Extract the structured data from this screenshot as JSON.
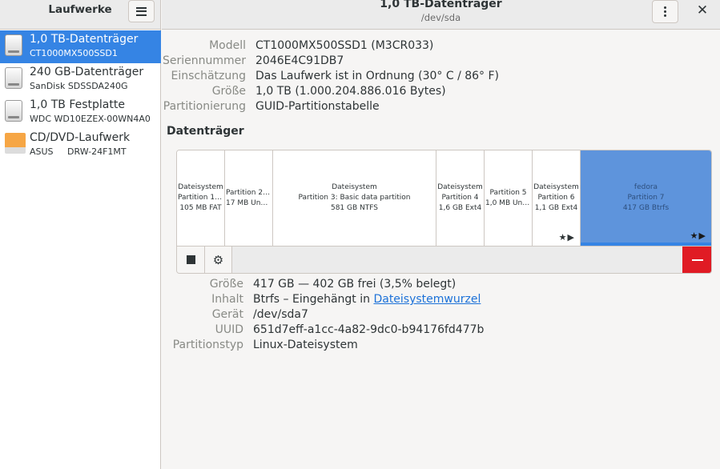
{
  "sidebar": {
    "title": "Laufwerke",
    "drives": [
      {
        "name": "1,0 TB-Datenträger",
        "model": "CT1000MX500SSD1",
        "icon": "hard-disk-icon"
      },
      {
        "name": "240 GB-Datenträger",
        "model": "SanDisk SDSSDA240G",
        "icon": "hard-disk-icon"
      },
      {
        "name": "1,0 TB Festplatte",
        "model": "WDC WD10EZEX-00WN4A0",
        "icon": "hard-disk-icon"
      },
      {
        "name": "CD/DVD-Laufwerk",
        "model": "ASUS     DRW-24F1MT",
        "icon": "optical-drive-icon"
      }
    ]
  },
  "header": {
    "title": "1,0 TB-Datenträger",
    "subtitle": "/dev/sda"
  },
  "drive_info": {
    "model_label": "Modell",
    "model": "CT1000MX500SSD1 (M3CR033)",
    "serial_label": "Seriennummer",
    "serial": "2046E4C91DB7",
    "assessment_label": "Einschätzung",
    "assessment": "Das Laufwerk ist in Ordnung (30° C / 86° F)",
    "size_label": "Größe",
    "size": "1,0 TB (1.000.204.886.016 Bytes)",
    "partitioning_label": "Partitionierung",
    "partitioning": "GUID-Partitionstabelle"
  },
  "section_title": "Datenträger",
  "partitions": [
    {
      "l1": "Dateisystem",
      "l2": "Partition 1: E...",
      "l3": "105 MB FAT",
      "marks": ""
    },
    {
      "l1": "",
      "l2": "Partition 2: ...",
      "l3": "17 MB Unbe...",
      "marks": ""
    },
    {
      "l1": "Dateisystem",
      "l2": "Partition 3: Basic data partition",
      "l3": "581 GB NTFS",
      "marks": ""
    },
    {
      "l1": "Dateisystem",
      "l2": "Partition 4",
      "l3": "1,6 GB Ext4",
      "marks": ""
    },
    {
      "l1": "",
      "l2": "Partition 5",
      "l3": "1,0 MB Unb...",
      "marks": ""
    },
    {
      "l1": "Dateisystem",
      "l2": "Partition 6",
      "l3": "1,1 GB Ext4",
      "marks": "★▶"
    },
    {
      "l1": "fedora",
      "l2": "Partition 7",
      "l3": "417 GB Btrfs",
      "marks": "★▶"
    }
  ],
  "partition_info": {
    "size_label": "Größe",
    "size": "417 GB — 402 GB frei (3,5% belegt)",
    "content_label": "Inhalt",
    "content_prefix": "Btrfs – Eingehängt in ",
    "content_link": "Dateisystemwurzel",
    "device_label": "Gerät",
    "device": "/dev/sda7",
    "uuid_label": "UUID",
    "uuid": "651d7eff-a1cc-4a82-9dc0-b94176fd477b",
    "type_label": "Partitionstyp",
    "type": "Linux-Dateisystem"
  },
  "colors": {
    "accent": "#3584e4",
    "selected_partition": "#5e94dc",
    "danger": "#e01b24",
    "drive_icon": "#f6a645"
  }
}
